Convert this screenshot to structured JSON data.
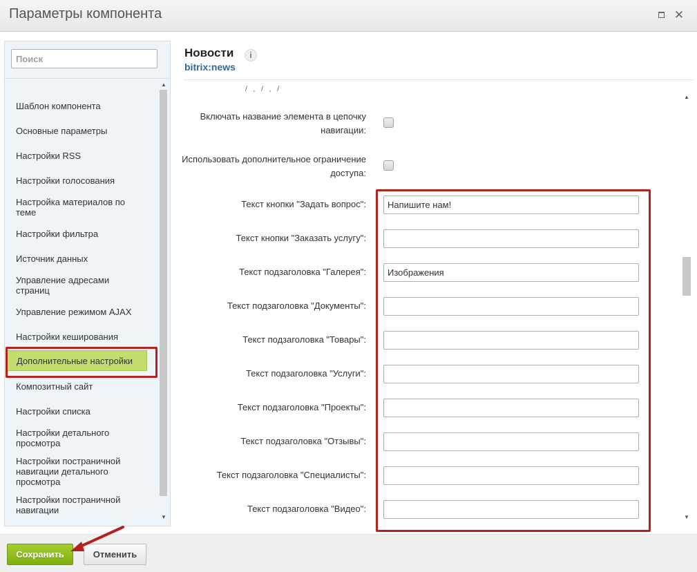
{
  "window": {
    "title": "Параметры компонента",
    "maximize_icon": "maximize-icon",
    "close_icon": "close-icon",
    "close_glyph": "✕"
  },
  "sidebar": {
    "search_placeholder": "Поиск",
    "items": [
      {
        "label": "Шаблон компонента"
      },
      {
        "label": "Основные параметры"
      },
      {
        "label": "Настройки RSS"
      },
      {
        "label": "Настройки голосования"
      },
      {
        "label": "Настройка материалов по теме"
      },
      {
        "label": "Настройки фильтра"
      },
      {
        "label": "Источник данных"
      },
      {
        "label": "Управление адресами страниц"
      },
      {
        "label": "Управление режимом AJAX"
      },
      {
        "label": "Настройки кеширования"
      },
      {
        "label": "Дополнительные настройки",
        "active": true
      },
      {
        "label": "Композитный сайт"
      },
      {
        "label": "Настройки списка"
      },
      {
        "label": "Настройки детального просмотра"
      },
      {
        "label": "Настройки постраничной навигации детального просмотра"
      },
      {
        "label": "Настройки постраничной навигации"
      }
    ]
  },
  "header": {
    "title": "Новости",
    "info_glyph": "i",
    "subtitle": "bitrix:news"
  },
  "settings": {
    "cut_text": "/ , / , /",
    "checkbox_rows": [
      {
        "label": "Включать название элемента в цепочку навигации:",
        "checked": false
      },
      {
        "label": "Использовать дополнительное ограничение доступа:",
        "checked": false
      }
    ],
    "text_rows": [
      {
        "label": "Текст кнопки \"Задать вопрос\":",
        "value": "Напишите нам!"
      },
      {
        "label": "Текст кнопки \"Заказать услугу\":",
        "value": ""
      },
      {
        "label": "Текст подзаголовка \"Галерея\":",
        "value": "Изображения"
      },
      {
        "label": "Текст подзаголовка \"Документы\":",
        "value": ""
      },
      {
        "label": "Текст подзаголовка \"Товары\":",
        "value": ""
      },
      {
        "label": "Текст подзаголовка \"Услуги\":",
        "value": ""
      },
      {
        "label": "Текст подзаголовка \"Проекты\":",
        "value": ""
      },
      {
        "label": "Текст подзаголовка \"Отзывы\":",
        "value": ""
      },
      {
        "label": "Текст подзаголовка \"Специалисты\":",
        "value": ""
      },
      {
        "label": "Текст подзаголовка \"Видео\":",
        "value": ""
      }
    ]
  },
  "footer": {
    "save_label": "Сохранить",
    "cancel_label": "Отменить"
  },
  "colors": {
    "accent_green": "#8fbf1f",
    "highlight_red": "#b3231c",
    "link_blue": "#2a6a9c"
  },
  "scroll": {
    "up_glyph": "▲",
    "down_glyph": "▼"
  }
}
